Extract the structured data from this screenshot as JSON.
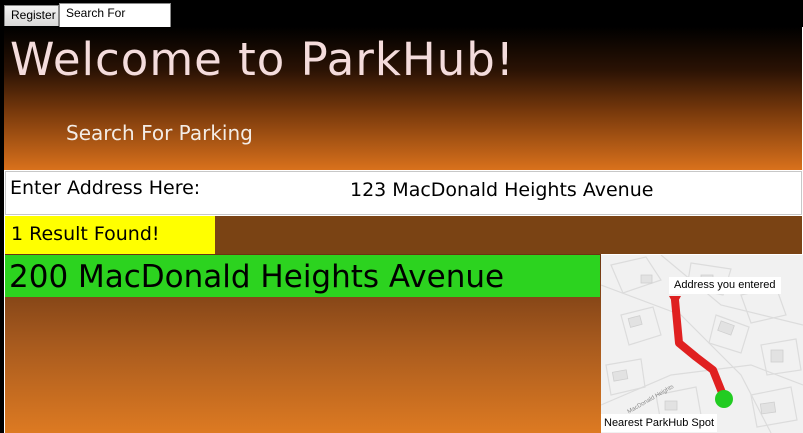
{
  "tabs": [
    {
      "label": "Register",
      "active": false
    },
    {
      "label": "Search For Parking",
      "active": true
    }
  ],
  "header": {
    "title": "Welcome to ParkHub!",
    "subtitle": "Search For Parking"
  },
  "search": {
    "label": "Enter Address Here:",
    "value": "123 MacDonald Heights Avenue"
  },
  "results": {
    "count_text": "1 Result Found!",
    "items": [
      {
        "address": "200 MacDonald Heights Avenue"
      }
    ]
  },
  "map": {
    "origin_label": "Address you entered",
    "destination_label": "Nearest ParkHub Spot",
    "street_label": "MacDonald Heights",
    "route_color": "#e02020",
    "destination_color": "#22cc22"
  },
  "colors": {
    "result_highlight": "#ffff00",
    "result_address_bg": "#2cd31f"
  }
}
